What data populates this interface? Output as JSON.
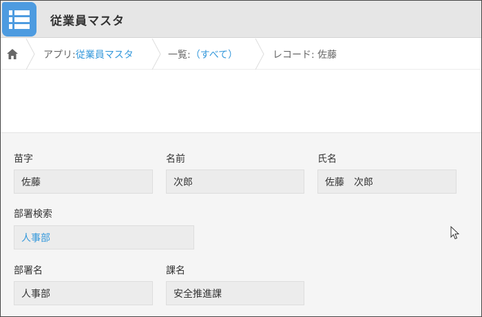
{
  "header": {
    "app_title": "従業員マスタ",
    "app_icon": "list-icon",
    "accent_color": "#4d9be0"
  },
  "breadcrumb": {
    "home_icon": "home-icon",
    "app_prefix": "アプリ: ",
    "app_name": "従業員マスタ",
    "list_prefix": "一覧: ",
    "list_name": "（すべて）",
    "record_label": "レコード: 佐藤"
  },
  "form": {
    "fields": [
      {
        "label": "苗字",
        "value": "佐藤"
      },
      {
        "label": "名前",
        "value": "次郎"
      },
      {
        "label": "氏名",
        "value": "佐藤　次郎"
      },
      {
        "label": "部署検索",
        "value": "人事部"
      },
      {
        "label": "部署名",
        "value": "人事部"
      },
      {
        "label": "課名",
        "value": "安全推進課"
      }
    ]
  },
  "colors": {
    "link": "#3498db",
    "form_background": "#f5f5f5",
    "field_background": "#ececec"
  }
}
